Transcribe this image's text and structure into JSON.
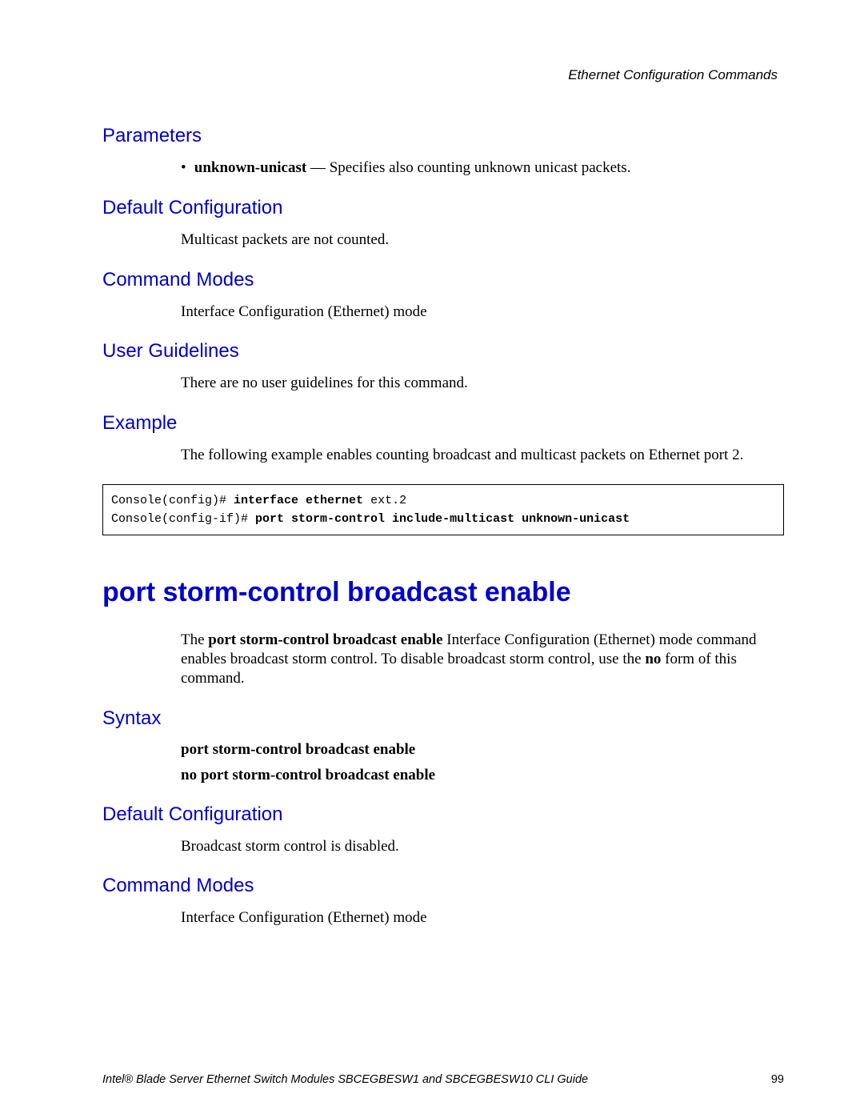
{
  "header": {
    "chapter": "Ethernet Configuration Commands"
  },
  "sections": {
    "parameters": {
      "title": "Parameters",
      "bullet_prefix": "•",
      "bullet_bold": "unknown-unicast",
      "bullet_rest": " — Specifies also counting unknown unicast packets."
    },
    "default_config1": {
      "title": "Default Configuration",
      "body": "Multicast packets are not counted."
    },
    "command_modes1": {
      "title": "Command Modes",
      "body": "Interface Configuration (Ethernet) mode"
    },
    "user_guidelines": {
      "title": "User Guidelines",
      "body": "There are no user guidelines for this command."
    },
    "example": {
      "title": "Example",
      "body": "The following example enables counting broadcast and multicast packets on Ethernet port 2.",
      "code": {
        "line1_a": "Console(config)# ",
        "line1_b": "interface ethernet ",
        "line1_c": "ext.2",
        "line2_a": "Console(config-if)# ",
        "line2_b": "port storm-control include-multicast unknown-unicast"
      }
    },
    "main_heading": "port storm-control broadcast enable",
    "intro": {
      "prefix": "The ",
      "bold": "port storm-control broadcast enable",
      "mid": " Interface Configuration (Ethernet) mode command enables broadcast storm control. To disable broadcast storm control, use the ",
      "bold2": "no",
      "suffix": " form of this command."
    },
    "syntax": {
      "title": "Syntax",
      "line1": "port storm-control broadcast enable",
      "line2": "no port storm-control broadcast enable"
    },
    "default_config2": {
      "title": "Default Configuration",
      "body": "Broadcast storm control is disabled."
    },
    "command_modes2": {
      "title": "Command Modes",
      "body": "Interface Configuration (Ethernet) mode"
    }
  },
  "footer": {
    "text": "Intel® Blade Server Ethernet Switch Modules SBCEGBESW1 and SBCEGBESW10 CLI Guide",
    "page": "99"
  }
}
